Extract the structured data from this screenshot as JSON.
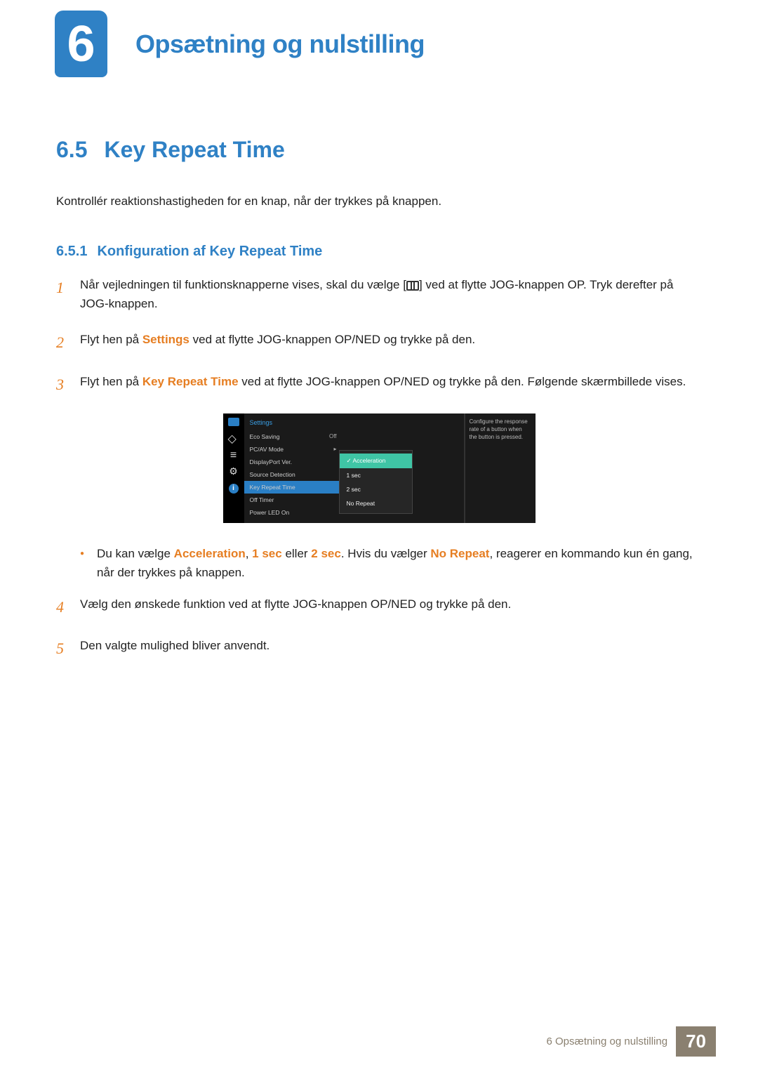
{
  "chapter": {
    "number": "6",
    "title": "Opsætning og nulstilling"
  },
  "section": {
    "number": "6.5",
    "title": "Key Repeat Time",
    "intro": "Kontrollér reaktionshastigheden for en knap, når der trykkes på knappen."
  },
  "subsection": {
    "number": "6.5.1",
    "title": "Konfiguration af Key Repeat Time"
  },
  "steps": [
    {
      "num": "1",
      "text_before": "Når vejledningen til funktionsknapperne vises, skal du vælge [",
      "text_after": "] ved at flytte JOG-knappen OP. Tryk derefter på JOG-knappen."
    },
    {
      "num": "2",
      "text_before": "Flyt hen på ",
      "highlight": "Settings",
      "text_after": " ved at flytte JOG-knappen OP/NED og trykke på den."
    },
    {
      "num": "3",
      "text_before": "Flyt hen på ",
      "highlight": "Key Repeat Time",
      "text_after": " ved at flytte JOG-knappen OP/NED og trykke på den. Følgende skærmbillede vises."
    },
    {
      "num": "4",
      "text_plain": "Vælg den ønskede funktion ved at flytte JOG-knappen OP/NED og trykke på den."
    },
    {
      "num": "5",
      "text_plain": "Den valgte mulighed bliver anvendt."
    }
  ],
  "osd": {
    "menu_title": "Settings",
    "items": [
      {
        "label": "Eco Saving",
        "value": "Off"
      },
      {
        "label": "PC/AV Mode",
        "value": "▸"
      },
      {
        "label": "DisplayPort Ver.",
        "value": ""
      },
      {
        "label": "Source Detection",
        "value": ""
      },
      {
        "label": "Key Repeat Time",
        "value": ""
      },
      {
        "label": "Off Timer",
        "value": ""
      },
      {
        "label": "Power LED On",
        "value": ""
      }
    ],
    "popup": [
      "Acceleration",
      "1 sec",
      "2 sec",
      "No Repeat"
    ],
    "description": "Configure the response rate of a button when the button is pressed."
  },
  "bullet": {
    "parts": {
      "t1": "Du kan vælge ",
      "h1": "Acceleration",
      "t2": ", ",
      "h2": "1 sec",
      "t3": " eller ",
      "h3": "2 sec",
      "t4": ". Hvis du vælger ",
      "h4": "No Repeat",
      "t5": ", reagerer en kommando kun én gang, når der trykkes på knappen."
    }
  },
  "footer": {
    "text": "6 Opsætning og nulstilling",
    "page": "70"
  }
}
